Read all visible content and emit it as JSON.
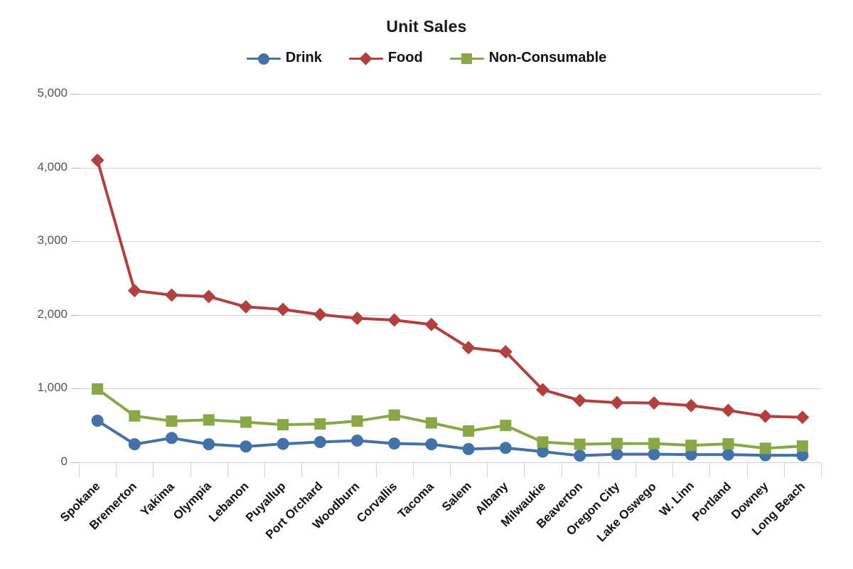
{
  "chart": {
    "title": "Unit Sales"
  },
  "legend": {
    "position": "top-center",
    "items": [
      {
        "label": "Drink",
        "color": "#4472a8",
        "marker": "circle"
      },
      {
        "label": "Food",
        "color": "#b0413e",
        "marker": "diamond"
      },
      {
        "label": "Non-Consumable",
        "color": "#8aa748",
        "marker": "square"
      }
    ]
  },
  "yaxis": {
    "ticks": [
      "0",
      "1,000",
      "2,000",
      "3,000",
      "4,000",
      "5,000"
    ]
  },
  "chart_data": {
    "type": "line",
    "title": "Unit Sales",
    "xlabel": "",
    "ylabel": "",
    "ylim": [
      0,
      5000
    ],
    "ytick_values": [
      0,
      1000,
      2000,
      3000,
      4000,
      5000
    ],
    "grid": true,
    "legend_position": "top-center",
    "categories": [
      "Spokane",
      "Bremerton",
      "Yakima",
      "Olympia",
      "Lebanon",
      "Puyallup",
      "Port Orchard",
      "Woodburn",
      "Corvallis",
      "Tacoma",
      "Salem",
      "Albany",
      "Milwaukie",
      "Beaverton",
      "Oregon City",
      "Lake Oswego",
      "W. Linn",
      "Portland",
      "Downey",
      "Long Beach"
    ],
    "series": [
      {
        "name": "Drink",
        "color": "#4472a8",
        "marker": "circle",
        "values": [
          565,
          245,
          330,
          245,
          215,
          250,
          275,
          295,
          255,
          245,
          180,
          195,
          145,
          90,
          110,
          110,
          105,
          105,
          95,
          95
        ]
      },
      {
        "name": "Food",
        "color": "#b0413e",
        "marker": "diamond",
        "values": [
          4100,
          2330,
          2270,
          2250,
          2110,
          2075,
          2005,
          1955,
          1930,
          1870,
          1555,
          1500,
          985,
          840,
          810,
          805,
          770,
          705,
          625,
          610
        ]
      },
      {
        "name": "Non-Consumable",
        "color": "#8aa748",
        "marker": "square",
        "values": [
          995,
          630,
          560,
          575,
          545,
          510,
          520,
          560,
          640,
          535,
          425,
          500,
          275,
          245,
          255,
          255,
          230,
          250,
          190,
          220
        ]
      }
    ]
  }
}
